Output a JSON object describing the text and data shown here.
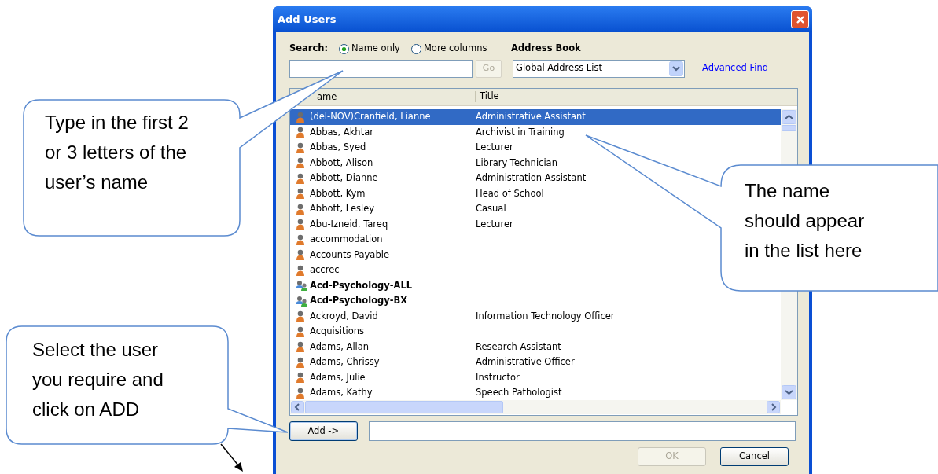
{
  "window": {
    "title": "Add Users"
  },
  "search": {
    "label": "Search:",
    "options": [
      {
        "label": "Name only",
        "selected": true
      },
      {
        "label": "More columns",
        "selected": false
      }
    ],
    "go_button": "Go",
    "go_disabled": true
  },
  "address_book": {
    "label": "Address Book",
    "value": "Global Address List",
    "advanced_find": "Advanced Find"
  },
  "table": {
    "columns": [
      "ame",
      "Title"
    ],
    "rows": [
      {
        "kind": "user",
        "name": "(del-NOV)Cranfield, Lianne",
        "title": "Administrative Assistant",
        "selected": true
      },
      {
        "kind": "user",
        "name": "Abbas, Akhtar",
        "title": "Archivist in Training",
        "selected": false
      },
      {
        "kind": "user",
        "name": "Abbas, Syed",
        "title": "Lecturer",
        "selected": false
      },
      {
        "kind": "user",
        "name": "Abbott, Alison",
        "title": "Library Technician",
        "selected": false
      },
      {
        "kind": "user",
        "name": "Abbott, Dianne",
        "title": "Administration Assistant",
        "selected": false
      },
      {
        "kind": "user",
        "name": "Abbott, Kym",
        "title": "Head of School",
        "selected": false
      },
      {
        "kind": "user",
        "name": "Abbott, Lesley",
        "title": "Casual",
        "selected": false
      },
      {
        "kind": "user",
        "name": "Abu-Izneid, Tareq",
        "title": "Lecturer",
        "selected": false
      },
      {
        "kind": "user",
        "name": "accommodation",
        "selected": false
      },
      {
        "kind": "user",
        "name": "Accounts Payable",
        "selected": false
      },
      {
        "kind": "user",
        "name": "accrec",
        "selected": false
      },
      {
        "kind": "group",
        "name": "Acd-Psychology-ALL",
        "selected": false
      },
      {
        "kind": "group",
        "name": "Acd-Psychology-BX",
        "selected": false
      },
      {
        "kind": "user",
        "name": "Ackroyd, David",
        "title": "Information Technology Officer",
        "selected": false
      },
      {
        "kind": "user",
        "name": "Acquisitions",
        "selected": false
      },
      {
        "kind": "user",
        "name": "Adams, Allan",
        "title": "Research Assistant",
        "selected": false
      },
      {
        "kind": "user",
        "name": "Adams, Chrissy",
        "title": "Administrative Officer",
        "selected": false
      },
      {
        "kind": "user",
        "name": "Adams, Julie",
        "title": "Instructor",
        "selected": false
      },
      {
        "kind": "user",
        "name": "Adams, Kathy",
        "title": "Speech Pathologist",
        "selected": false
      }
    ]
  },
  "add_button": "Add ->",
  "buttons": [
    {
      "label": "OK",
      "disabled": true
    },
    {
      "label": "Cancel",
      "disabled": false
    }
  ],
  "callouts": [
    {
      "text": "Type in the first 2 or 3 letters of the user’s name"
    },
    {
      "text": "The name should appear in the list here"
    },
    {
      "text": "Select the user you require and click on ADD"
    }
  ]
}
